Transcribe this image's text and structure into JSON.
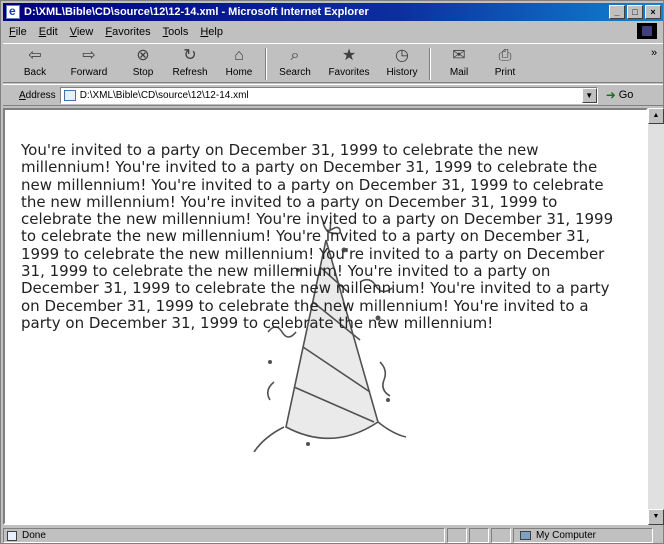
{
  "window": {
    "title": "D:\\XML\\Bible\\CD\\source\\12\\12-14.xml - Microsoft Internet Explorer",
    "controls": {
      "minimize": "_",
      "maximize": "□",
      "close": "×"
    }
  },
  "menu": {
    "items": [
      {
        "label": "File"
      },
      {
        "label": "Edit"
      },
      {
        "label": "View"
      },
      {
        "label": "Favorites"
      },
      {
        "label": "Tools"
      },
      {
        "label": "Help"
      }
    ]
  },
  "toolbar": {
    "buttons": [
      {
        "label": "Back",
        "icon": "back-arrow-icon",
        "glyph": "⇦"
      },
      {
        "label": "Forward",
        "icon": "forward-arrow-icon",
        "glyph": "⇨"
      },
      {
        "label": "Stop",
        "icon": "stop-icon",
        "glyph": "⊗"
      },
      {
        "label": "Refresh",
        "icon": "refresh-icon",
        "glyph": "↻"
      },
      {
        "label": "Home",
        "icon": "home-icon",
        "glyph": "⌂"
      },
      {
        "label": "Search",
        "icon": "search-icon",
        "glyph": "⌕"
      },
      {
        "label": "Favorites",
        "icon": "favorites-icon",
        "glyph": "★"
      },
      {
        "label": "History",
        "icon": "history-icon",
        "glyph": "◷"
      },
      {
        "label": "Mail",
        "icon": "mail-icon",
        "glyph": "✉"
      },
      {
        "label": "Print",
        "icon": "print-icon",
        "glyph": "⎙"
      }
    ],
    "overflow": "»"
  },
  "address": {
    "label": "Address",
    "url": "D:\\XML\\Bible\\CD\\source\\12\\12-14.xml",
    "go_label": "Go"
  },
  "content": {
    "text": "You're invited to a party on December 31, 1999 to celebrate the new millennium! You're invited to a party on December 31, 1999 to celebrate the new millennium! You're invited to a party on December 31, 1999 to celebrate the new millennium! You're invited to a party on December 31, 1999 to celebrate the new millennium! You're invited to a party on December 31, 1999 to celebrate the new millennium! You're invited to a party on December 31, 1999 to celebrate the new millennium! You're invited to a party on December 31, 1999 to celebrate the new millennium! You're invited to a party on December 31, 1999 to celebrate the new millennium! You're invited to a party on December 31, 1999 to celebrate the new millennium! You're invited to a party on December 31, 1999 to celebrate the new millennium!",
    "background_image": "party-hat-icon"
  },
  "status": {
    "text": "Done",
    "zone": "My Computer"
  },
  "colors": {
    "title_bar": "#000080",
    "chrome": "#c0c0c0",
    "page_bg": "#ffffff",
    "text": "#222222"
  }
}
